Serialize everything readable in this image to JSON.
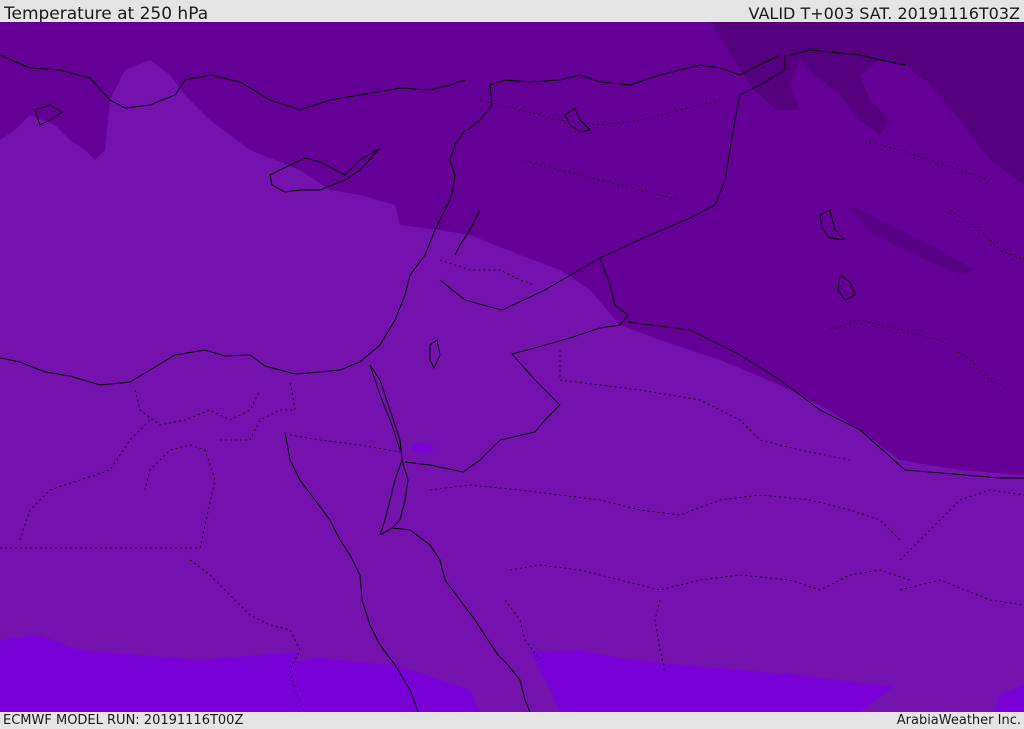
{
  "header": {
    "title": "Temperature at 250 hPa",
    "valid_time": "VALID T+003 SAT. 20191116T03Z"
  },
  "footer": {
    "model_run": "ECMWF MODEL RUN: 20191116T00Z",
    "credit": "ArabiaWeather Inc."
  },
  "colors": {
    "coldest": "#54007f",
    "cold": "#650097",
    "medium": "#7412ae",
    "warm": "#7a00d8",
    "border": "#000000"
  }
}
